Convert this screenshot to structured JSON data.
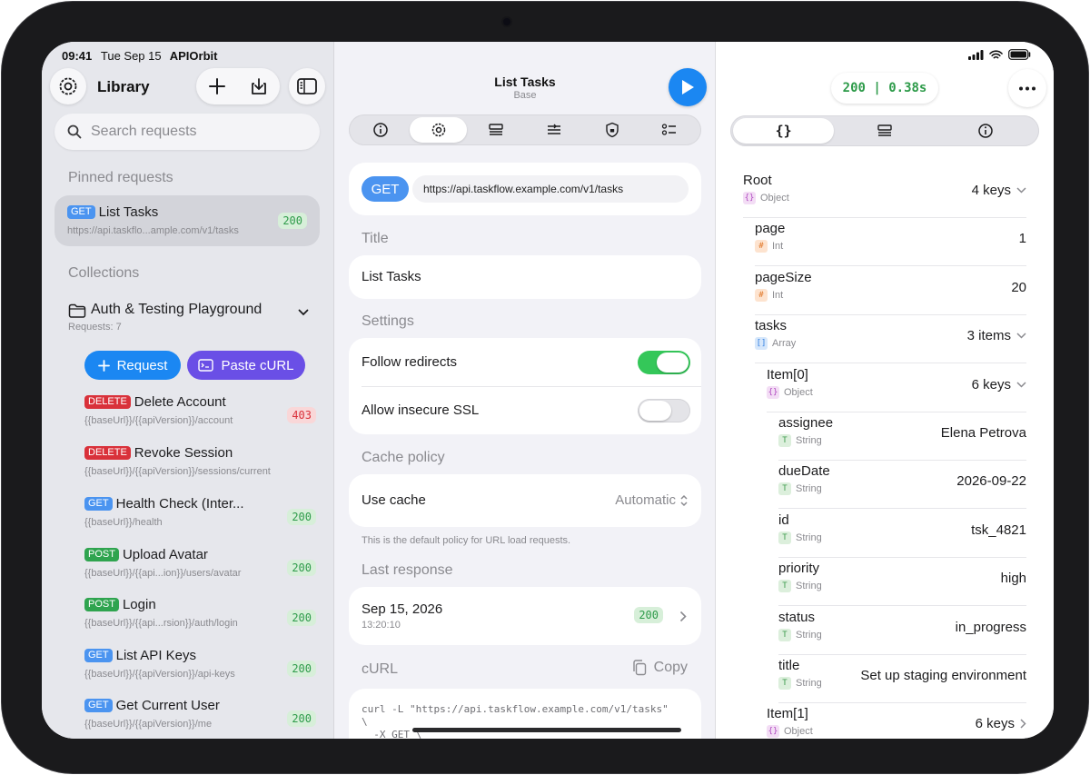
{
  "status_bar": {
    "time": "09:41",
    "date": "Tue Sep 15",
    "app": "APIOrbit"
  },
  "sidebar": {
    "title": "Library",
    "search_placeholder": "Search requests",
    "pinned_heading": "Pinned requests",
    "pinned": {
      "method": "GET",
      "name": "List Tasks",
      "url": "https://api.taskflo...ample.com/v1/tasks",
      "code": "200"
    },
    "collections_heading": "Collections",
    "collection": {
      "name": "Auth & Testing Playground",
      "count": "Requests: 7"
    },
    "add_request_label": "Request",
    "paste_curl_label": "Paste cURL",
    "requests": [
      {
        "method": "DELETE",
        "name": "Delete Account",
        "url": "{{baseUrl}}/{{apiVersion}}/account",
        "code": "403"
      },
      {
        "method": "DELETE",
        "name": "Revoke Session",
        "url": "{{baseUrl}}/{{apiVersion}}/sessions/current",
        "code": ""
      },
      {
        "method": "GET",
        "name": "Health Check (Inter...",
        "url": "{{baseUrl}}/health",
        "code": "200"
      },
      {
        "method": "POST",
        "name": "Upload Avatar",
        "url": "{{baseUrl}}/{{api...ion}}/users/avatar",
        "code": "200"
      },
      {
        "method": "POST",
        "name": "Login",
        "url": "{{baseUrl}}/{{api...rsion}}/auth/login",
        "code": "200"
      },
      {
        "method": "GET",
        "name": "List API Keys",
        "url": "{{baseUrl}}/{{apiVersion}}/api-keys",
        "code": "200"
      },
      {
        "method": "GET",
        "name": "Get Current User",
        "url": "{{baseUrl}}/{{apiVersion}}/me",
        "code": "200"
      }
    ]
  },
  "editor": {
    "title": "List Tasks",
    "subtitle": "Base",
    "method": "GET",
    "url": "https://api.taskflow.example.com/v1/tasks",
    "title_heading": "Title",
    "title_value": "List Tasks",
    "settings_heading": "Settings",
    "follow_redirects_label": "Follow redirects",
    "follow_redirects": true,
    "insecure_ssl_label": "Allow insecure SSL",
    "insecure_ssl": false,
    "cache_heading": "Cache policy",
    "use_cache_label": "Use cache",
    "use_cache_value": "Automatic",
    "cache_hint": "This is the default policy for URL load requests.",
    "last_response_heading": "Last response",
    "last_response_date": "Sep 15, 2026",
    "last_response_time": "13:20:10",
    "last_response_code": "200",
    "curl_heading": "cURL",
    "copy_label": "Copy",
    "curl_text": "curl -L \"https://api.taskflow.example.com/v1/tasks\"\n\\\n  -X GET \\"
  },
  "response": {
    "status": "200 | 0.38s",
    "tree": [
      {
        "key": "Root",
        "type": "Object",
        "icon": "{}",
        "kind": "obj",
        "value": "4 keys",
        "chevron": "down",
        "depth": 0
      },
      {
        "key": "page",
        "type": "Int",
        "icon": "#",
        "kind": "int",
        "value": "1",
        "chevron": "",
        "depth": 1
      },
      {
        "key": "pageSize",
        "type": "Int",
        "icon": "#",
        "kind": "int",
        "value": "20",
        "chevron": "",
        "depth": 1
      },
      {
        "key": "tasks",
        "type": "Array",
        "icon": "[]",
        "kind": "arr",
        "value": "3 items",
        "chevron": "down",
        "depth": 1
      },
      {
        "key": "Item[0]",
        "type": "Object",
        "icon": "{}",
        "kind": "obj",
        "value": "6 keys",
        "chevron": "down",
        "depth": 2
      },
      {
        "key": "assignee",
        "type": "String",
        "icon": "T",
        "kind": "str",
        "value": "Elena Petrova",
        "chevron": "",
        "depth": 3
      },
      {
        "key": "dueDate",
        "type": "String",
        "icon": "T",
        "kind": "str",
        "value": "2026-09-22",
        "chevron": "",
        "depth": 3
      },
      {
        "key": "id",
        "type": "String",
        "icon": "T",
        "kind": "str",
        "value": "tsk_4821",
        "chevron": "",
        "depth": 3
      },
      {
        "key": "priority",
        "type": "String",
        "icon": "T",
        "kind": "str",
        "value": "high",
        "chevron": "",
        "depth": 3
      },
      {
        "key": "status",
        "type": "String",
        "icon": "T",
        "kind": "str",
        "value": "in_progress",
        "chevron": "",
        "depth": 3
      },
      {
        "key": "title",
        "type": "String",
        "icon": "T",
        "kind": "str",
        "value": "Set up staging environment",
        "chevron": "",
        "depth": 3
      },
      {
        "key": "Item[1]",
        "type": "Object",
        "icon": "{}",
        "kind": "obj",
        "value": "6 keys",
        "chevron": "right",
        "depth": 2
      }
    ]
  },
  "colors": {
    "accent": "#1b87f2",
    "get": "#4b94f0",
    "delete": "#d9313a",
    "post": "#2fa44f",
    "success": "#34c759",
    "purple": "#6a4fe6"
  }
}
